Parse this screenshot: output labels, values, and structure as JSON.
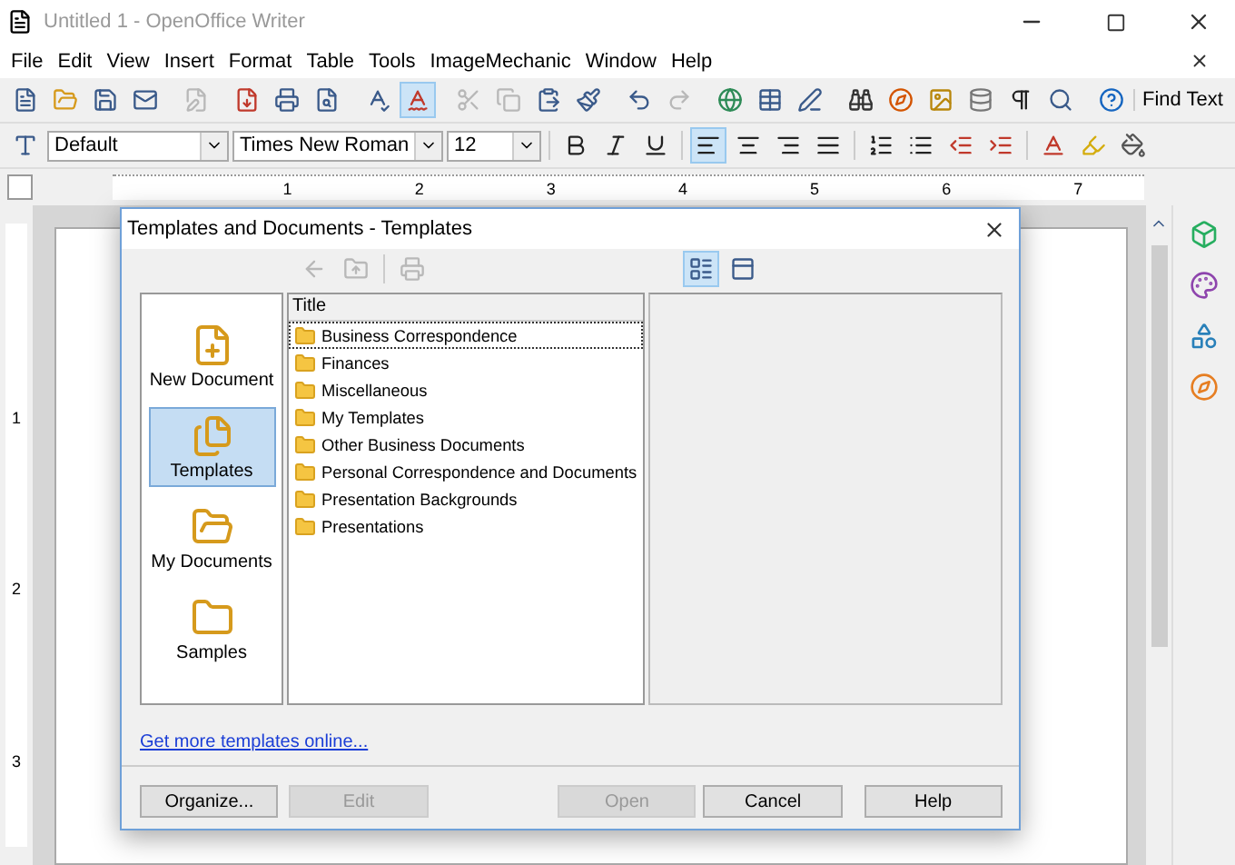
{
  "window": {
    "title": "Untitled 1 - OpenOffice Writer"
  },
  "menu": [
    "File",
    "Edit",
    "View",
    "Insert",
    "Format",
    "Table",
    "Tools",
    "ImageMechanic",
    "Window",
    "Help"
  ],
  "toolbar": {
    "autospellcheck_on": true,
    "find_label": "Find Text"
  },
  "format_bar": {
    "style": "Default",
    "font": "Times New Roman",
    "size": "12",
    "align_buttons": [
      {
        "kind": "left",
        "selected": true
      },
      {
        "kind": "center",
        "selected": false
      },
      {
        "kind": "right",
        "selected": false
      },
      {
        "kind": "justify",
        "selected": false
      }
    ]
  },
  "ruler": {
    "marks": [
      "1",
      "2",
      "3",
      "4",
      "5",
      "6",
      "7"
    ]
  },
  "vertical_ruler": {
    "marks": [
      "1",
      "2",
      "3"
    ]
  },
  "dialog": {
    "title": "Templates and Documents - Templates",
    "view_buttons": [
      {
        "kind": "list",
        "selected": true
      },
      {
        "kind": "preview",
        "selected": false
      }
    ],
    "categories": [
      {
        "label": "New Document",
        "kind": "new",
        "selected": false
      },
      {
        "label": "Templates",
        "kind": "templates",
        "selected": true
      },
      {
        "label": "My Documents",
        "kind": "documents",
        "selected": false
      },
      {
        "label": "Samples",
        "kind": "samples",
        "selected": false
      }
    ],
    "column": "Title",
    "items": [
      {
        "label": "Business Correspondence",
        "selected": true
      },
      {
        "label": "Finances",
        "selected": false
      },
      {
        "label": "Miscellaneous",
        "selected": false
      },
      {
        "label": "My Templates",
        "selected": false
      },
      {
        "label": "Other Business Documents",
        "selected": false
      },
      {
        "label": "Personal Correspondence and Documents",
        "selected": false
      },
      {
        "label": "Presentation Backgrounds",
        "selected": false
      },
      {
        "label": "Presentations",
        "selected": false
      }
    ],
    "link": "Get more templates online...",
    "buttons": [
      {
        "label": "Organize...",
        "disabled": false
      },
      {
        "label": "Edit",
        "disabled": true
      },
      {
        "label": "Open",
        "disabled": true
      },
      {
        "label": "Cancel",
        "disabled": false
      },
      {
        "label": "Help",
        "disabled": false
      }
    ]
  }
}
